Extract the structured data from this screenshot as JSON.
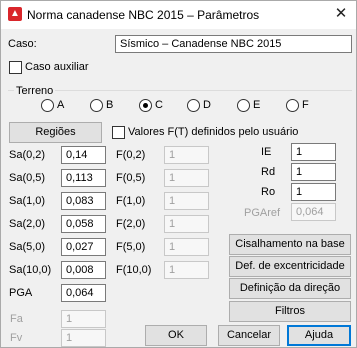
{
  "window": {
    "title": "Norma canadense NBC 2015 – Parâmetros",
    "close_glyph": "✕"
  },
  "caso": {
    "label": "Caso:",
    "value": "Sísmico – Canadense NBC 2015"
  },
  "caso_auxiliar": {
    "label": "Caso auxiliar",
    "checked": false
  },
  "terreno": {
    "label": "Terreno",
    "options": [
      "A",
      "B",
      "C",
      "D",
      "E",
      "F"
    ],
    "selected": "C"
  },
  "regioes_button": "Regiões",
  "valores_ft": {
    "label": "Valores F(T) definidos pelo usuário",
    "checked": false
  },
  "sa": {
    "labels": [
      "Sa(0,2)",
      "Sa(0,5)",
      "Sa(1,0)",
      "Sa(2,0)",
      "Sa(5,0)",
      "Sa(10,0)"
    ],
    "values": [
      "0,14",
      "0,113",
      "0,083",
      "0,058",
      "0,027",
      "0,008"
    ]
  },
  "pga": {
    "label": "PGA",
    "value": "0,064"
  },
  "f": {
    "labels": [
      "F(0,2)",
      "F(0,5)",
      "F(1,0)",
      "F(2,0)",
      "F(5,0)",
      "F(10,0)"
    ],
    "values": [
      "1",
      "1",
      "1",
      "1",
      "1",
      "1"
    ]
  },
  "right_params": {
    "ie": {
      "label": "IE",
      "value": "1"
    },
    "rd": {
      "label": "Rd",
      "value": "1"
    },
    "ro": {
      "label": "Ro",
      "value": "1"
    },
    "pgaref": {
      "label": "PGAref",
      "value": "0,064"
    }
  },
  "side_buttons": {
    "cisalhamento": "Cisalhamento na base",
    "excentricidade": "Def. de excentricidade",
    "direcao": "Definição da direção",
    "filtros": "Filtros"
  },
  "fa": {
    "label": "Fa",
    "value": "1"
  },
  "fv": {
    "label": "Fv",
    "value": "1"
  },
  "footer": {
    "ok": "OK",
    "cancelar": "Cancelar",
    "ajuda": "Ajuda"
  }
}
